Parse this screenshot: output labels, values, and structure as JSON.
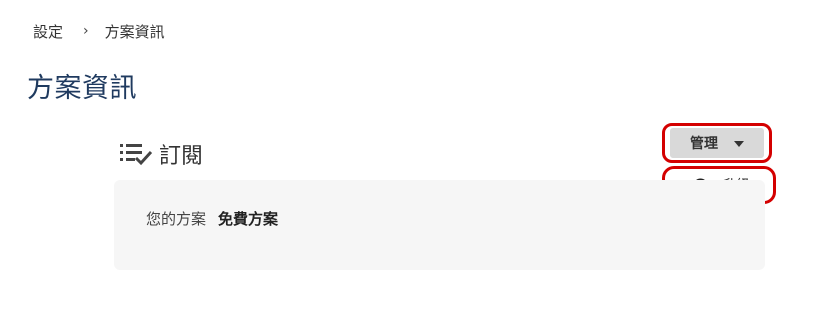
{
  "breadcrumb": {
    "items": [
      {
        "label": "設定"
      },
      {
        "label": "方案資訊"
      }
    ],
    "separator": "›"
  },
  "page": {
    "title": "方案資訊"
  },
  "subscription": {
    "icon": "playlist-check-icon",
    "title": "訂閱",
    "plan_label": "您的方案",
    "plan_value": "免費方案"
  },
  "manage": {
    "label": "管理",
    "icon": "caret-down-icon",
    "menu": [
      {
        "label": "升級",
        "icon": "rocket-badge-icon"
      }
    ]
  },
  "colors": {
    "title": "#1f3a5f",
    "highlight": "#d40000",
    "button_bg": "#d9d9d9",
    "card_bg": "#f6f6f6"
  }
}
